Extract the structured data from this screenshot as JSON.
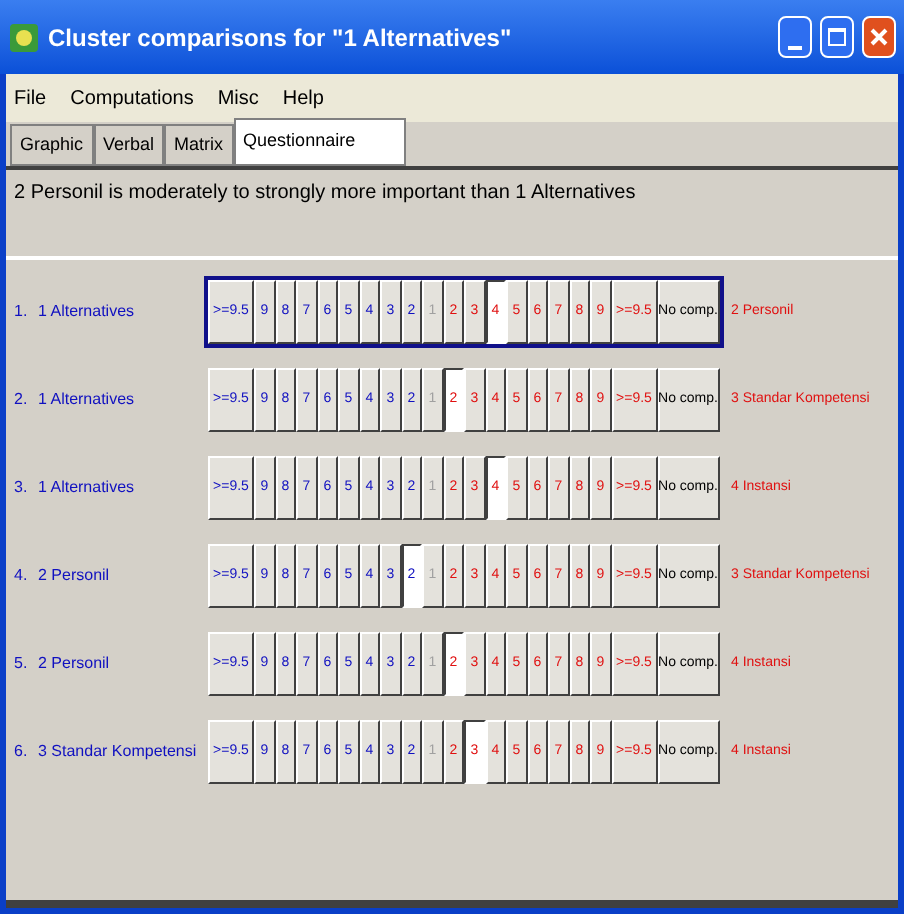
{
  "window": {
    "title": "Cluster comparisons for \"1 Alternatives\""
  },
  "menu": [
    "File",
    "Computations",
    "Misc",
    "Help"
  ],
  "tabs": [
    {
      "label": "Graphic",
      "selected": false
    },
    {
      "label": "Verbal",
      "selected": false
    },
    {
      "label": "Matrix",
      "selected": false
    },
    {
      "label": "Questionnaire",
      "selected": true
    }
  ],
  "statement": "2 Personil is moderately to strongly more important than 1 Alternatives",
  "comparisons": [
    {
      "number": "1.",
      "left": "1 Alternatives",
      "right": "2 Personil",
      "focused": true,
      "buttons": [
        {
          "label": ">=9.5",
          "selected": false
        },
        {
          "label": "9",
          "selected": false
        },
        {
          "label": "8",
          "selected": false
        },
        {
          "label": "7",
          "selected": false
        },
        {
          "label": "6",
          "selected": false
        },
        {
          "label": "5",
          "selected": false
        },
        {
          "label": "4",
          "selected": false
        },
        {
          "label": "3",
          "selected": false
        },
        {
          "label": "2",
          "selected": false
        },
        {
          "label": "1",
          "selected": false
        },
        {
          "label": "2",
          "selected": false
        },
        {
          "label": "3",
          "selected": false
        },
        {
          "label": "4",
          "selected": true
        },
        {
          "label": "5",
          "selected": false
        },
        {
          "label": "6",
          "selected": false
        },
        {
          "label": "7",
          "selected": false
        },
        {
          "label": "8",
          "selected": false
        },
        {
          "label": "9",
          "selected": false
        },
        {
          "label": ">=9.5",
          "selected": false
        },
        {
          "label": "No comp.",
          "selected": false
        }
      ]
    },
    {
      "number": "2.",
      "left": "1 Alternatives",
      "right": "3 Standar Kompetensi",
      "focused": false,
      "buttons": [
        {
          "label": ">=9.5",
          "selected": false
        },
        {
          "label": "9",
          "selected": false
        },
        {
          "label": "8",
          "selected": false
        },
        {
          "label": "7",
          "selected": false
        },
        {
          "label": "6",
          "selected": false
        },
        {
          "label": "5",
          "selected": false
        },
        {
          "label": "4",
          "selected": false
        },
        {
          "label": "3",
          "selected": false
        },
        {
          "label": "2",
          "selected": false
        },
        {
          "label": "1",
          "selected": false
        },
        {
          "label": "2",
          "selected": true
        },
        {
          "label": "3",
          "selected": false
        },
        {
          "label": "4",
          "selected": false
        },
        {
          "label": "5",
          "selected": false
        },
        {
          "label": "6",
          "selected": false
        },
        {
          "label": "7",
          "selected": false
        },
        {
          "label": "8",
          "selected": false
        },
        {
          "label": "9",
          "selected": false
        },
        {
          "label": ">=9.5",
          "selected": false
        },
        {
          "label": "No comp.",
          "selected": false
        }
      ]
    },
    {
      "number": "3.",
      "left": "1 Alternatives",
      "right": "4 Instansi",
      "focused": false,
      "buttons": [
        {
          "label": ">=9.5",
          "selected": false
        },
        {
          "label": "9",
          "selected": false
        },
        {
          "label": "8",
          "selected": false
        },
        {
          "label": "7",
          "selected": false
        },
        {
          "label": "6",
          "selected": false
        },
        {
          "label": "5",
          "selected": false
        },
        {
          "label": "4",
          "selected": false
        },
        {
          "label": "3",
          "selected": false
        },
        {
          "label": "2",
          "selected": false
        },
        {
          "label": "1",
          "selected": false
        },
        {
          "label": "2",
          "selected": false
        },
        {
          "label": "3",
          "selected": false
        },
        {
          "label": "4",
          "selected": true
        },
        {
          "label": "5",
          "selected": false
        },
        {
          "label": "6",
          "selected": false
        },
        {
          "label": "7",
          "selected": false
        },
        {
          "label": "8",
          "selected": false
        },
        {
          "label": "9",
          "selected": false
        },
        {
          "label": ">=9.5",
          "selected": false
        },
        {
          "label": "No comp.",
          "selected": false
        }
      ]
    },
    {
      "number": "4.",
      "left": "2 Personil",
      "right": "3 Standar Kompetensi",
      "focused": false,
      "buttons": [
        {
          "label": ">=9.5",
          "selected": false
        },
        {
          "label": "9",
          "selected": false
        },
        {
          "label": "8",
          "selected": false
        },
        {
          "label": "7",
          "selected": false
        },
        {
          "label": "6",
          "selected": false
        },
        {
          "label": "5",
          "selected": false
        },
        {
          "label": "4",
          "selected": false
        },
        {
          "label": "3",
          "selected": false
        },
        {
          "label": "2",
          "selected": true
        },
        {
          "label": "1",
          "selected": false
        },
        {
          "label": "2",
          "selected": false
        },
        {
          "label": "3",
          "selected": false
        },
        {
          "label": "4",
          "selected": false
        },
        {
          "label": "5",
          "selected": false
        },
        {
          "label": "6",
          "selected": false
        },
        {
          "label": "7",
          "selected": false
        },
        {
          "label": "8",
          "selected": false
        },
        {
          "label": "9",
          "selected": false
        },
        {
          "label": ">=9.5",
          "selected": false
        },
        {
          "label": "No comp.",
          "selected": false
        }
      ]
    },
    {
      "number": "5.",
      "left": "2 Personil",
      "right": "4 Instansi",
      "focused": false,
      "buttons": [
        {
          "label": ">=9.5",
          "selected": false
        },
        {
          "label": "9",
          "selected": false
        },
        {
          "label": "8",
          "selected": false
        },
        {
          "label": "7",
          "selected": false
        },
        {
          "label": "6",
          "selected": false
        },
        {
          "label": "5",
          "selected": false
        },
        {
          "label": "4",
          "selected": false
        },
        {
          "label": "3",
          "selected": false
        },
        {
          "label": "2",
          "selected": false
        },
        {
          "label": "1",
          "selected": false
        },
        {
          "label": "2",
          "selected": true
        },
        {
          "label": "3",
          "selected": false
        },
        {
          "label": "4",
          "selected": false
        },
        {
          "label": "5",
          "selected": false
        },
        {
          "label": "6",
          "selected": false
        },
        {
          "label": "7",
          "selected": false
        },
        {
          "label": "8",
          "selected": false
        },
        {
          "label": "9",
          "selected": false
        },
        {
          "label": ">=9.5",
          "selected": false
        },
        {
          "label": "No comp.",
          "selected": false
        }
      ]
    },
    {
      "number": "6.",
      "left": "3 Standar Kompetensi",
      "right": "4 Instansi",
      "focused": false,
      "buttons": [
        {
          "label": ">=9.5",
          "selected": false
        },
        {
          "label": "9",
          "selected": false
        },
        {
          "label": "8",
          "selected": false
        },
        {
          "label": "7",
          "selected": false
        },
        {
          "label": "6",
          "selected": false
        },
        {
          "label": "5",
          "selected": false
        },
        {
          "label": "4",
          "selected": false
        },
        {
          "label": "3",
          "selected": false
        },
        {
          "label": "2",
          "selected": false
        },
        {
          "label": "1",
          "selected": false
        },
        {
          "label": "2",
          "selected": false
        },
        {
          "label": "3",
          "selected": true
        },
        {
          "label": "4",
          "selected": false
        },
        {
          "label": "5",
          "selected": false
        },
        {
          "label": "6",
          "selected": false
        },
        {
          "label": "7",
          "selected": false
        },
        {
          "label": "8",
          "selected": false
        },
        {
          "label": "9",
          "selected": false
        },
        {
          "label": ">=9.5",
          "selected": false
        },
        {
          "label": "No comp.",
          "selected": false
        }
      ]
    }
  ]
}
